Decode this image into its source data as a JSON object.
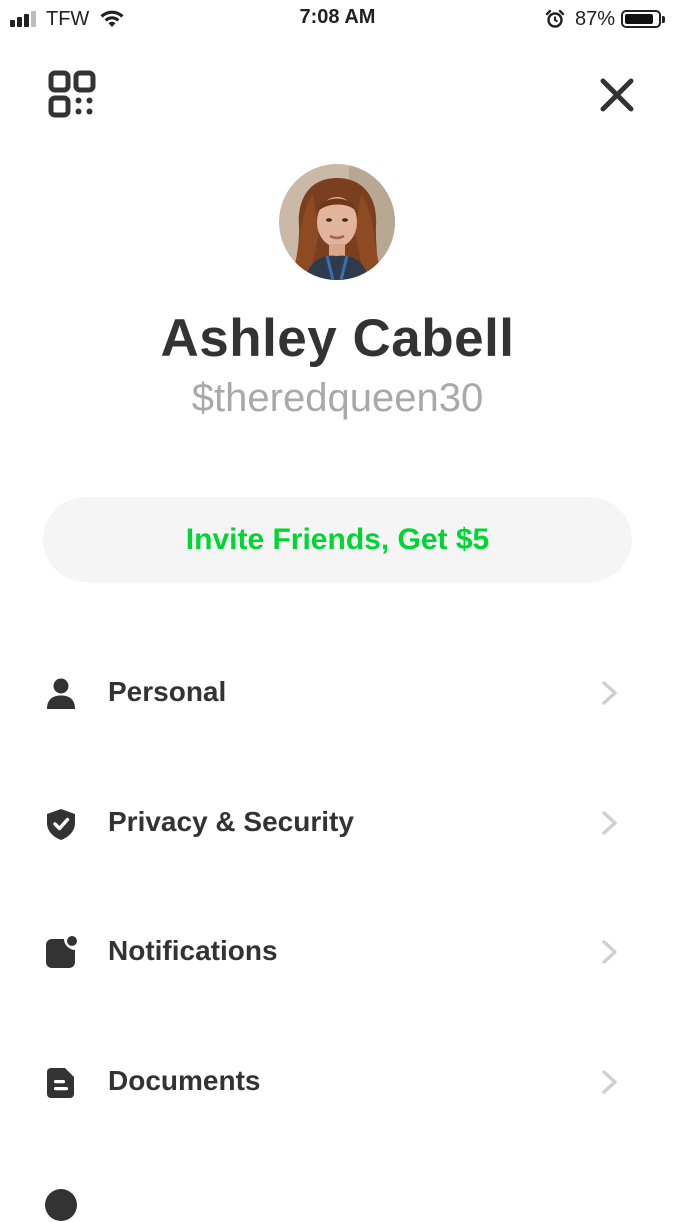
{
  "status_bar": {
    "carrier": "TFW",
    "time": "7:08 AM",
    "battery": "87%",
    "battery_level": 0.87
  },
  "header": {
    "qr_icon": "qr-code-icon",
    "close_icon": "close-icon"
  },
  "profile": {
    "name": "Ashley Cabell",
    "cashtag": "$theredqueen30"
  },
  "invite": {
    "label": "Invite Friends, Get $5",
    "color": "#00d632"
  },
  "menu": {
    "items": [
      {
        "label": "Personal",
        "icon": "person-icon"
      },
      {
        "label": "Privacy & Security",
        "icon": "shield-icon"
      },
      {
        "label": "Notifications",
        "icon": "notification-icon"
      },
      {
        "label": "Documents",
        "icon": "document-icon"
      }
    ]
  },
  "colors": {
    "accent": "#00d632",
    "text": "#333333",
    "muted": "#a9a9a9",
    "chevron": "#d0d0d0",
    "pill_background": "#f5f5f5"
  }
}
